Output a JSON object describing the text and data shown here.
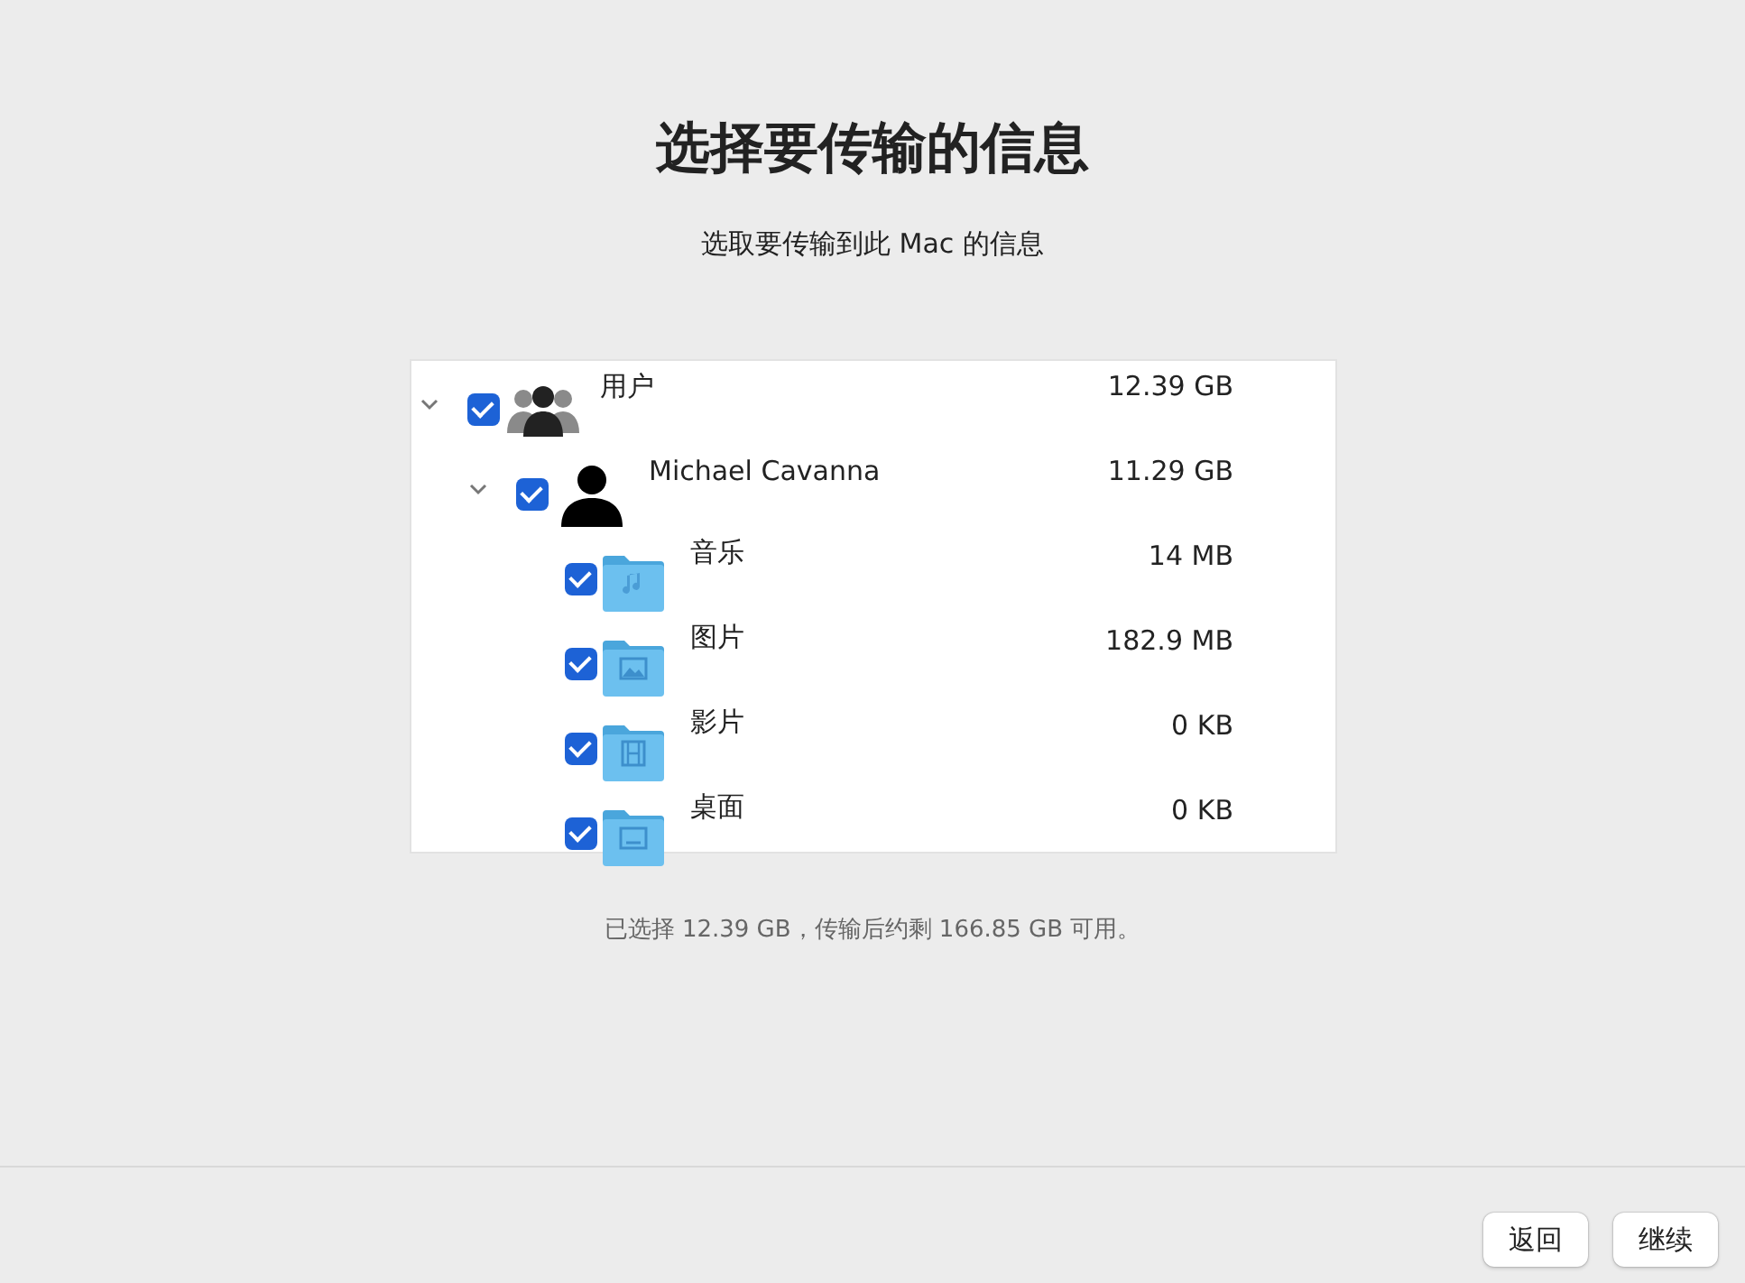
{
  "title": "选择要传输的信息",
  "subtitle": "选取要传输到此 Mac 的信息",
  "tree": [
    {
      "kind": "group",
      "label": "用户",
      "size": "12.39 GB",
      "checked": true,
      "expanded": true,
      "children": [
        {
          "kind": "person",
          "label": "Michael Cavanna",
          "size": "11.29 GB",
          "checked": true,
          "expanded": true,
          "children": [
            {
              "kind": "music",
              "label": "音乐",
              "size": "14 MB",
              "checked": true
            },
            {
              "kind": "pictures",
              "label": "图片",
              "size": "182.9 MB",
              "checked": true
            },
            {
              "kind": "movies",
              "label": "影片",
              "size": "0 KB",
              "checked": true
            },
            {
              "kind": "desktop",
              "label": "桌面",
              "size": "0 KB",
              "checked": true
            }
          ]
        }
      ]
    }
  ],
  "summary": "已选择 12.39 GB，传输后约剩 166.85 GB 可用。",
  "buttons": [
    "返回",
    "继续"
  ]
}
